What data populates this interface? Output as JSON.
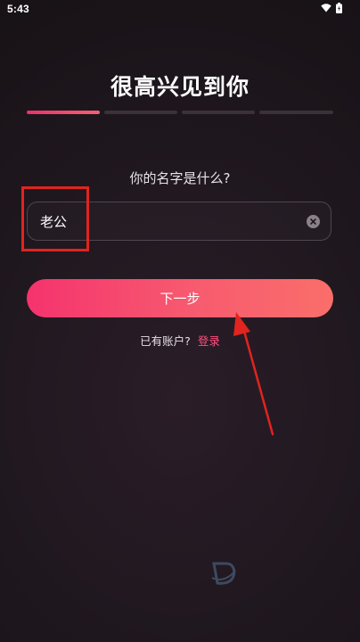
{
  "status_bar": {
    "time": "5:43",
    "wifi_icon": "wifi-icon",
    "battery_icon": "battery-icon"
  },
  "header": {
    "title": "很高兴见到你"
  },
  "progress": {
    "total_steps": 4,
    "current_step": 1,
    "active_color": "#e8336a",
    "inactive_color": "#3a3238"
  },
  "form": {
    "question": "你的名字是什么?",
    "name_value": "老公",
    "clear_icon": "clear-icon"
  },
  "actions": {
    "next_label": "下一步",
    "next_gradient": [
      "#f5336e",
      "#fa6e6a"
    ],
    "login_prompt": "已有账户?",
    "login_link": "登录",
    "login_link_color": "#ff4f7f"
  },
  "annotations": {
    "highlight_color": "#e0241e",
    "arrow_color": "#e0241e"
  }
}
